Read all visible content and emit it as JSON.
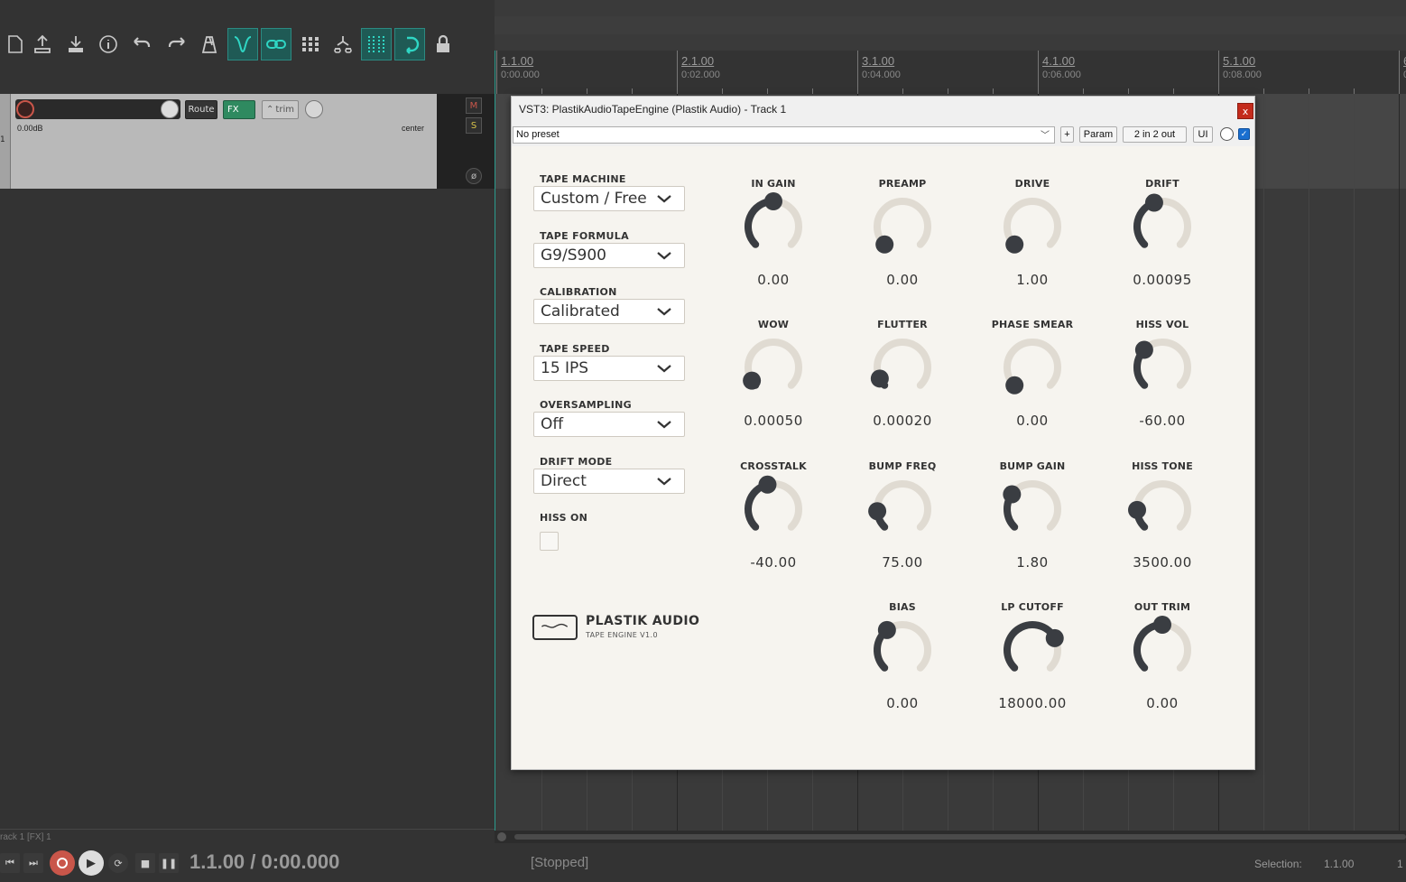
{
  "toolbar": {
    "icons": [
      "new-file-icon",
      "open-icon",
      "save-icon",
      "info-icon",
      "undo-icon",
      "redo-icon",
      "metronome-icon",
      "autocrossfade-icon",
      "grouping-icon",
      "envelope-icon",
      "ripple-icon",
      "snap-grid-icon",
      "loop-icon",
      "lock-icon"
    ]
  },
  "ruler": {
    "marks": [
      {
        "bar": "1.1.00",
        "time": "0:00.000"
      },
      {
        "bar": "2.1.00",
        "time": "0:02.000"
      },
      {
        "bar": "3.1.00",
        "time": "0:04.000"
      },
      {
        "bar": "4.1.00",
        "time": "0:06.000"
      },
      {
        "bar": "5.1.00",
        "time": "0:08.000"
      },
      {
        "bar": "6",
        "time": "0"
      }
    ]
  },
  "track": {
    "number": "1",
    "route_label": "Route",
    "fx_label": "FX",
    "trim_label": "trim",
    "volume": "0.00dB",
    "pan": "center",
    "mute_label": "M",
    "solo_label": "S",
    "phase_label": "ø"
  },
  "status": {
    "left_text": "rack 1 [FX] 1",
    "time": "1.1.00 / 0:00.000",
    "play_state": "[Stopped]",
    "selection_label": "Selection:",
    "selection_start": "1.1.00",
    "selection_end": "1"
  },
  "plugin": {
    "title": "VST3: PlastikAudioTapeEngine (Plastik Audio) - Track 1",
    "close_label": "x",
    "preset": "No preset",
    "plus_label": "+",
    "param_label": "Param",
    "io_label": "2 in 2 out",
    "ui_label": "UI",
    "left": {
      "tape_machine": {
        "label": "TAPE MACHINE",
        "value": "Custom / Free"
      },
      "tape_formula": {
        "label": "TAPE FORMULA",
        "value": "G9/S900"
      },
      "calibration": {
        "label": "CALIBRATION",
        "value": "Calibrated"
      },
      "tape_speed": {
        "label": "TAPE SPEED",
        "value": "15 IPS"
      },
      "oversampling": {
        "label": "OVERSAMPLING",
        "value": "Off"
      },
      "drift_mode": {
        "label": "DRIFT MODE",
        "value": "Direct"
      },
      "hiss_on": {
        "label": "HISS ON"
      }
    },
    "logo": {
      "name": "PLASTIK AUDIO",
      "sub": "TAPE ENGINE V1.0"
    },
    "knobs": [
      {
        "label": "IN GAIN",
        "value": "0.00",
        "level": 0.5
      },
      {
        "label": "PREAMP",
        "value": "0.00",
        "level": 0.0
      },
      {
        "label": "DRIVE",
        "value": "1.00",
        "level": 0.0
      },
      {
        "label": "DRIFT",
        "value": "0.00095",
        "level": 0.43
      },
      {
        "label": "WOW",
        "value": "0.00050",
        "level": 0.05
      },
      {
        "label": "FLUTTER",
        "value": "0.00020",
        "level": 0.07
      },
      {
        "label": "PHASE SMEAR",
        "value": "0.00",
        "level": 0.0
      },
      {
        "label": "HISS VOL",
        "value": "-60.00",
        "level": 0.33
      },
      {
        "label": "CROSSTALK",
        "value": "-40.00",
        "level": 0.45
      },
      {
        "label": "BUMP FREQ",
        "value": "75.00",
        "level": 0.15
      },
      {
        "label": "BUMP GAIN",
        "value": "1.80",
        "level": 0.3
      },
      {
        "label": "HISS TONE",
        "value": "3500.00",
        "level": 0.16
      },
      {
        "label": "BIAS",
        "value": "0.00",
        "level": 0.36
      },
      {
        "label": "LP CUTOFF",
        "value": "18000.00",
        "level": 0.73
      },
      {
        "label": "OUT TRIM",
        "value": "0.00",
        "level": 0.5
      }
    ],
    "colors": {
      "background": "#f6f4ef",
      "knob_track": "#e0dbd2",
      "knob_fill": "#3a3d42",
      "text": "#333333"
    }
  }
}
